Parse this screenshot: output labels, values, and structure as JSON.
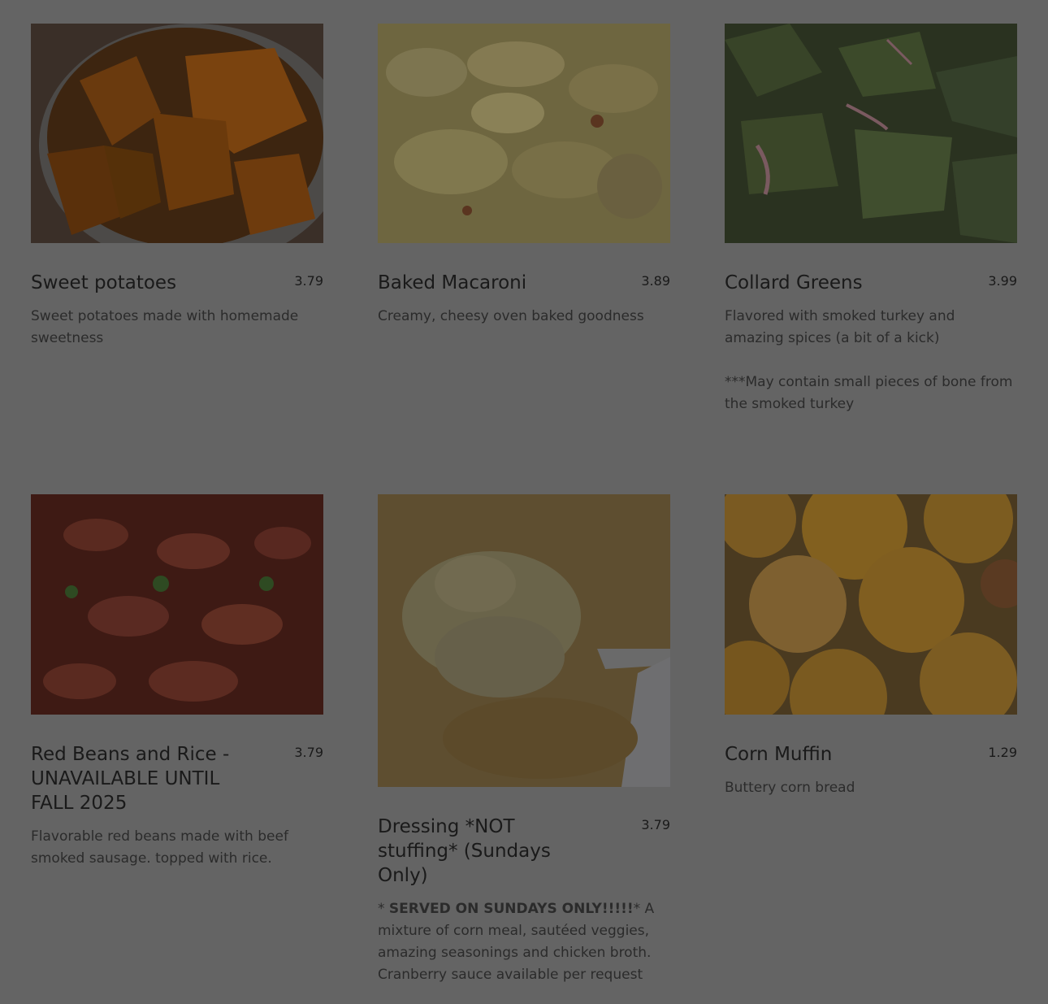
{
  "menu": {
    "items": [
      {
        "name": "Sweet potatoes",
        "price": "3.79",
        "description": "Sweet potatoes made with homemade sweetness",
        "image_icon": "sweet-potatoes-photo"
      },
      {
        "name": "Baked Macaroni",
        "price": "3.89",
        "description": "Creamy, cheesy oven baked goodness",
        "image_icon": "baked-macaroni-photo"
      },
      {
        "name": "Collard Greens",
        "price": "3.99",
        "description": "Flavored with smoked turkey and amazing spices (a bit of a kick)\n\n***May contain small pieces of bone from the smoked turkey",
        "image_icon": "collard-greens-photo"
      },
      {
        "name": "Red Beans and Rice - UNAVAILABLE UNTIL FALL 2025",
        "price": "3.79",
        "description": "Flavorable red beans made with beef smoked sausage. topped with rice.",
        "image_icon": "red-beans-rice-photo"
      },
      {
        "name": "Dressing *NOT stuffing* (Sundays Only)",
        "price": "3.79",
        "description_prefix": "* ",
        "description_bold": "SERVED ON SUNDAYS ONLY!!!!!",
        "description_rest": "* A mixture of corn meal, sautéed veggies, amazing seasonings and chicken broth. Cranberry sauce available per request",
        "image_icon": "dressing-photo"
      },
      {
        "name": "Corn Muffin",
        "price": "1.29",
        "description": "Buttery corn bread",
        "image_icon": "corn-muffin-photo"
      }
    ]
  },
  "colors": {
    "overlay": "#646464",
    "text": "#1a1a1a"
  }
}
